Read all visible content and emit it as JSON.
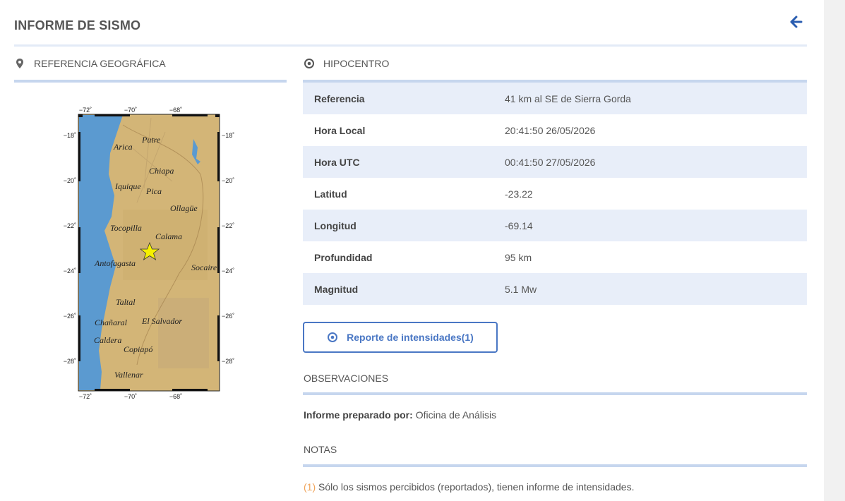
{
  "page": {
    "title": "INFORME DE SISMO"
  },
  "geo": {
    "heading": "REFERENCIA GEOGRÁFICA"
  },
  "map": {
    "lon_ticks": [
      "−72˚",
      "−70˚",
      "−68˚"
    ],
    "lat_ticks": [
      "−18˚",
      "−20˚",
      "−22˚",
      "−24˚",
      "−26˚",
      "−28˚"
    ],
    "lat_ticks_right": [
      "18˚",
      "20˚",
      "22˚",
      "24˚",
      "26˚",
      "28˚"
    ],
    "places": [
      {
        "name": "Arica"
      },
      {
        "name": "Putre"
      },
      {
        "name": "Chiapa"
      },
      {
        "name": "Iquique"
      },
      {
        "name": "Pica"
      },
      {
        "name": "Ollagüe"
      },
      {
        "name": "Tocopilla"
      },
      {
        "name": "Calama"
      },
      {
        "name": "Antofagasta"
      },
      {
        "name": "Socaire"
      },
      {
        "name": "Taltal"
      },
      {
        "name": "Chañaral"
      },
      {
        "name": "El Salvador"
      },
      {
        "name": "Caldera"
      },
      {
        "name": "Copiapó"
      },
      {
        "name": "Vallenar"
      }
    ],
    "colors": {
      "sea": "#5b9ad0",
      "land": "#d3b577",
      "star": "#f6f000"
    }
  },
  "hypo": {
    "heading": "HIPOCENTRO",
    "rows": [
      {
        "label": "Referencia",
        "value": "41 km al SE de Sierra Gorda"
      },
      {
        "label": "Hora Local",
        "value": "20:41:50 26/05/2026"
      },
      {
        "label": "Hora UTC",
        "value": "00:41:50 27/05/2026"
      },
      {
        "label": "Latitud",
        "value": "-23.22"
      },
      {
        "label": "Longitud",
        "value": "-69.14"
      },
      {
        "label": "Profundidad",
        "value": "95 km"
      },
      {
        "label": "Magnitud",
        "value": "5.1 Mw"
      }
    ]
  },
  "report_button": {
    "label": "Reporte de intensidades(1)"
  },
  "observaciones": {
    "heading": "OBSERVACIONES",
    "prepared_label": "Informe preparado por:",
    "prepared_value": "Oficina de Análisis"
  },
  "notas": {
    "heading": "NOTAS",
    "number": "(1)",
    "text": "Sólo los sismos percibidos (reportados), tienen informe de intensidades."
  },
  "colors": {
    "accent": "#4a77c4",
    "rule": "#c6d6ee",
    "row_alt": "#e8eef9",
    "note_num": "#f0a45a"
  }
}
